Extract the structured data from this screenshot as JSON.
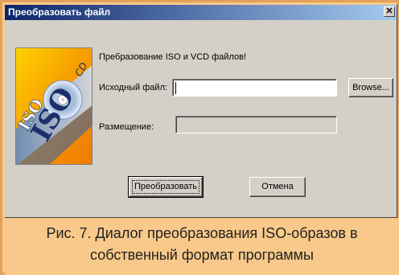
{
  "dialog": {
    "title": "Преобразовать файл",
    "close_symbol": "✕",
    "logo": {
      "text_large": "ISO",
      "text_small": "ISO",
      "text_cd": "CD",
      "icon": "disc-icon"
    },
    "description": "Пребразование ISO и VCD файлов!",
    "source_label": "Исходный файл:",
    "source_value": "",
    "browse_label": "Browse...",
    "placement_label": "Размещение:",
    "placement_value": "",
    "convert_label": "Преобразовать",
    "cancel_label": "Отмена"
  },
  "caption": {
    "line1": "Рис. 7. Диалог преобразования ISO-образов в",
    "line2": "собственный формат программы"
  },
  "colors": {
    "title_bar": "#0a246a",
    "window_face": "#d4d0c8",
    "caption_background": "#f8c98a",
    "caption_border": "#e2a25c"
  }
}
